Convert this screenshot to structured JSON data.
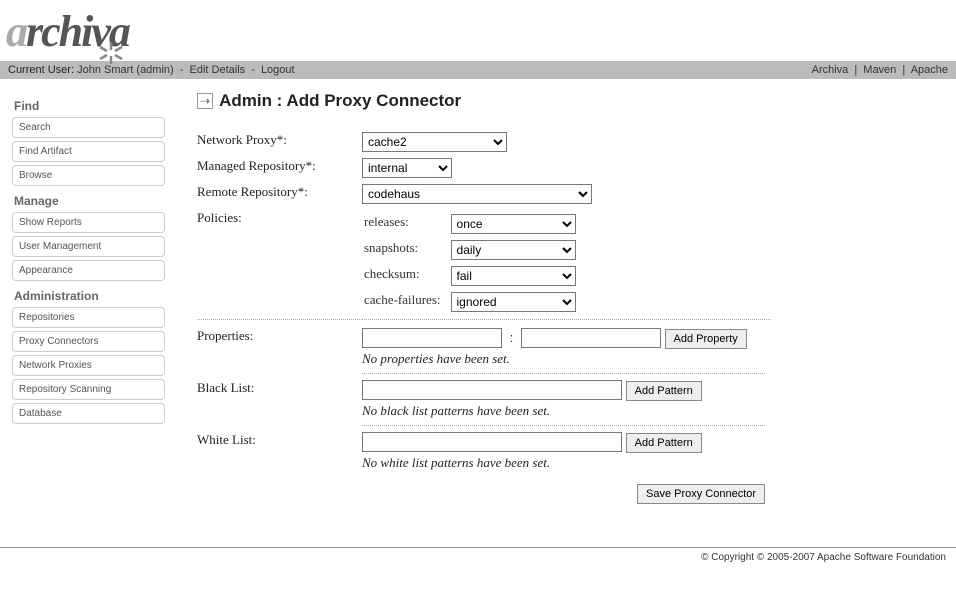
{
  "logo": {
    "part1": "a",
    "part2": "rchiva"
  },
  "userbar": {
    "current_user_label": "Current User:",
    "user_name": "John Smart",
    "user_role": "(admin)",
    "edit_details": "Edit Details",
    "logout": "Logout",
    "links": {
      "archiva": "Archiva",
      "maven": "Maven",
      "apache": "Apache"
    }
  },
  "sidebar": {
    "find": {
      "heading": "Find",
      "search": "Search",
      "find_artifact": "Find Artifact",
      "browse": "Browse"
    },
    "manage": {
      "heading": "Manage",
      "show_reports": "Show Reports",
      "user_management": "User Management",
      "appearance": "Appearance"
    },
    "admin": {
      "heading": "Administration",
      "repositories": "Repositories",
      "proxy_connectors": "Proxy Connectors",
      "network_proxies": "Network Proxies",
      "repository_scanning": "Repository Scanning",
      "database": "Database"
    }
  },
  "page": {
    "title": "Admin : Add Proxy Connector",
    "labels": {
      "network_proxy": "Network Proxy*:",
      "managed_repository": "Managed Repository*:",
      "remote_repository": "Remote Repository*:",
      "policies": "Policies:",
      "releases": "releases:",
      "snapshots": "snapshots:",
      "checksum": "checksum:",
      "cache_failures": "cache-failures:",
      "properties": "Properties:",
      "black_list": "Black List:",
      "white_list": "White List:"
    },
    "values": {
      "network_proxy": "cache2",
      "managed_repository": "internal",
      "remote_repository": "codehaus",
      "releases": "once",
      "snapshots": "daily",
      "checksum": "fail",
      "cache_failures": "ignored"
    },
    "buttons": {
      "add_property": "Add Property",
      "add_pattern_black": "Add Pattern",
      "add_pattern_white": "Add Pattern",
      "save": "Save Proxy Connector"
    },
    "messages": {
      "no_properties": "No properties have been set.",
      "no_blacklist": "No black list patterns have been set.",
      "no_whitelist": "No white list patterns have been set."
    }
  },
  "footer": {
    "copyright": "© Copyright © 2005-2007 Apache Software Foundation"
  }
}
